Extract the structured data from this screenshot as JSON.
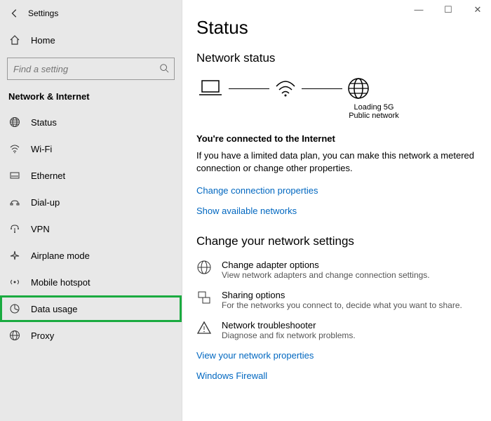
{
  "title": "Settings",
  "search_placeholder": "Find a setting",
  "section": "Network & Internet",
  "nav": {
    "home": "Home",
    "status": "Status",
    "wifi": "Wi-Fi",
    "ethernet": "Ethernet",
    "dialup": "Dial-up",
    "vpn": "VPN",
    "airplane": "Airplane mode",
    "hotspot": "Mobile hotspot",
    "datausage": "Data usage",
    "proxy": "Proxy"
  },
  "page": {
    "heading": "Status",
    "subheading": "Network status",
    "net_name": "Loading 5G",
    "net_type": "Public network",
    "connected_title": "You're connected to the Internet",
    "connected_body": "If you have a limited data plan, you can make this network a metered connection or change other properties.",
    "link_props": "Change connection properties",
    "link_avail": "Show available networks",
    "change_heading": "Change your network settings",
    "opt1_t": "Change adapter options",
    "opt1_s": "View network adapters and change connection settings.",
    "opt2_t": "Sharing options",
    "opt2_s": "For the networks you connect to, decide what you want to share.",
    "opt3_t": "Network troubleshooter",
    "opt3_s": "Diagnose and fix network problems.",
    "link_viewprops": "View your network properties",
    "link_firewall": "Windows Firewall"
  }
}
